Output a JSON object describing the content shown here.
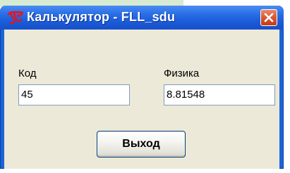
{
  "window": {
    "title": "Калькулятор  - FLL_sdu",
    "app_icon": "red-script-logo-icon",
    "close_icon": "close-icon"
  },
  "form": {
    "code_label": "Код",
    "code_value": "45",
    "physics_label": "Физика",
    "physics_value": "8.81548"
  },
  "actions": {
    "exit_label": "Выход"
  },
  "colors": {
    "titlebar": "#1b64d8",
    "client_bg": "#ece9d8",
    "close_button": "#d9532d",
    "field_border": "#7f9db9"
  }
}
